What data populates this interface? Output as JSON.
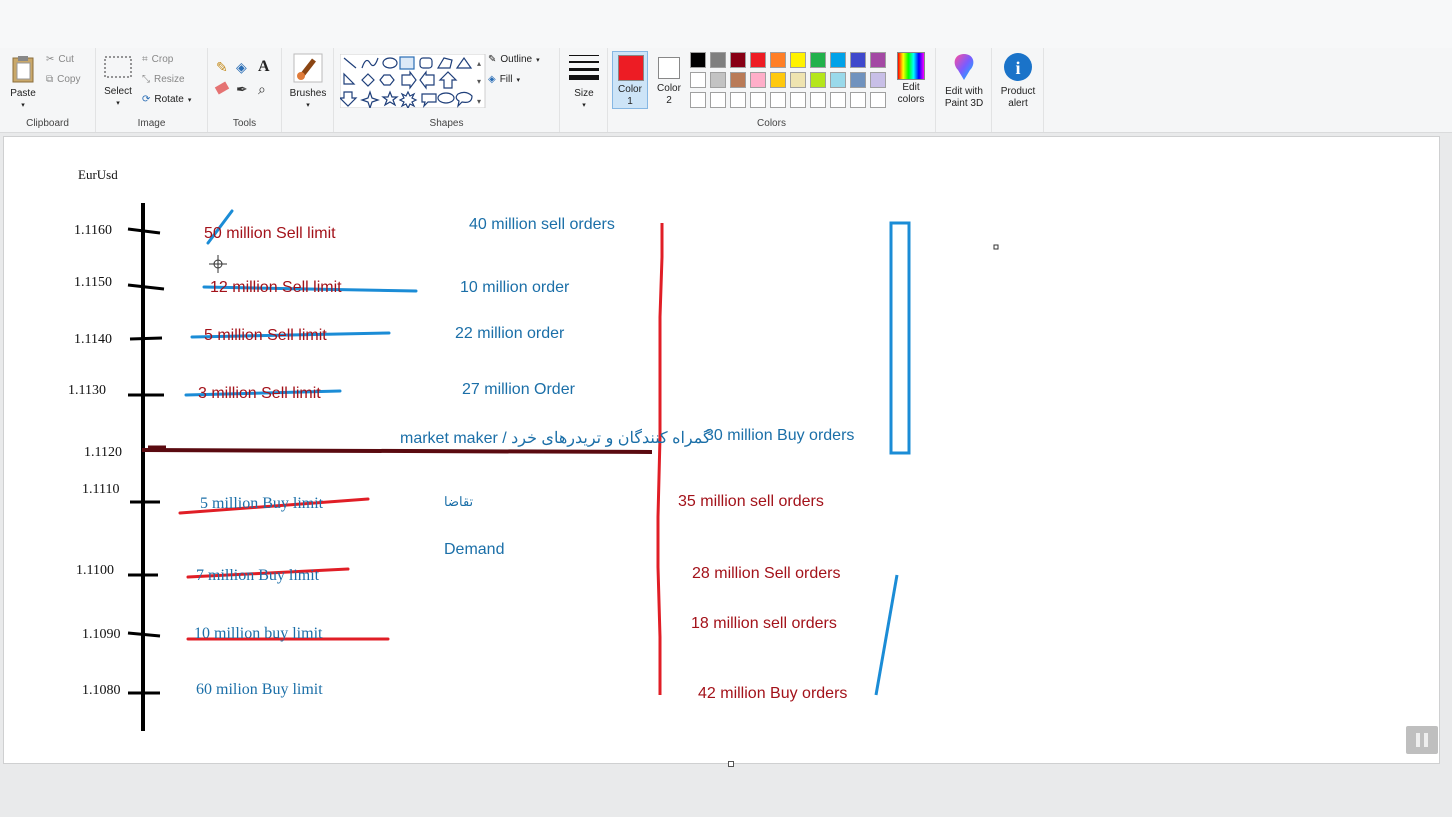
{
  "ribbon": {
    "clipboard": {
      "paste": "Paste",
      "cut": "Cut",
      "copy": "Copy",
      "label": "Clipboard"
    },
    "image": {
      "select": "Select",
      "crop": "Crop",
      "resize": "Resize",
      "rotate": "Rotate",
      "label": "Image"
    },
    "tools": {
      "label": "Tools"
    },
    "brushes": {
      "label": "Brushes"
    },
    "shapes": {
      "outline": "Outline",
      "fill": "Fill",
      "label": "Shapes"
    },
    "size": {
      "label": "Size"
    },
    "color1": {
      "line1": "Color",
      "line2": "1"
    },
    "color2": {
      "line1": "Color",
      "line2": "2"
    },
    "colors": {
      "label": "Colors",
      "row1": [
        "#000000",
        "#7f7f7f",
        "#880015",
        "#ed1c24",
        "#ff7f27",
        "#fff200",
        "#22b14c",
        "#00a2e8",
        "#3f48cc",
        "#a349a4"
      ],
      "row2": [
        "#ffffff",
        "#c3c3c3",
        "#b97a57",
        "#ffaec9",
        "#ffc90e",
        "#efe4b0",
        "#b5e61d",
        "#99d9ea",
        "#7092be",
        "#c8bfe7"
      ],
      "row3": [
        "#ffffff",
        "#ffffff",
        "#ffffff",
        "#ffffff",
        "#ffffff",
        "#ffffff",
        "#ffffff",
        "#ffffff",
        "#ffffff",
        "#ffffff"
      ]
    },
    "edit_colors": {
      "line1": "Edit",
      "line2": "colors"
    },
    "paint3d": {
      "line1": "Edit with",
      "line2": "Paint 3D"
    },
    "product_alert": {
      "line1": "Product",
      "line2": "alert"
    },
    "color1_value": "#ed1c24",
    "color2_value": "#ffffff"
  },
  "drawing": {
    "title": "EurUsd",
    "prices": [
      "1.1160",
      "1.1150",
      "1.1140",
      "1.1130",
      "1.1120",
      "1.1110",
      "1.1100",
      "1.1090",
      "1.1080"
    ],
    "left_orders": [
      "50 million Sell limit",
      "12 million Sell limit",
      "5 million Sell limit",
      "3 million Sell limit",
      "5 million Buy limit",
      "7 million Buy limit",
      "10 million buy limit",
      "60 milion Buy limit"
    ],
    "middle": [
      "40 million sell orders",
      "10 million order",
      "22 million order",
      "27 million Order",
      "market maker / گمراه کنندگان و تریدرهای خرد",
      "تقاضا",
      "Demand"
    ],
    "right": [
      "30  million Buy orders",
      "35 million  sell orders",
      "28 million Sell orders",
      "18 million sell orders",
      "42 million Buy orders"
    ]
  }
}
